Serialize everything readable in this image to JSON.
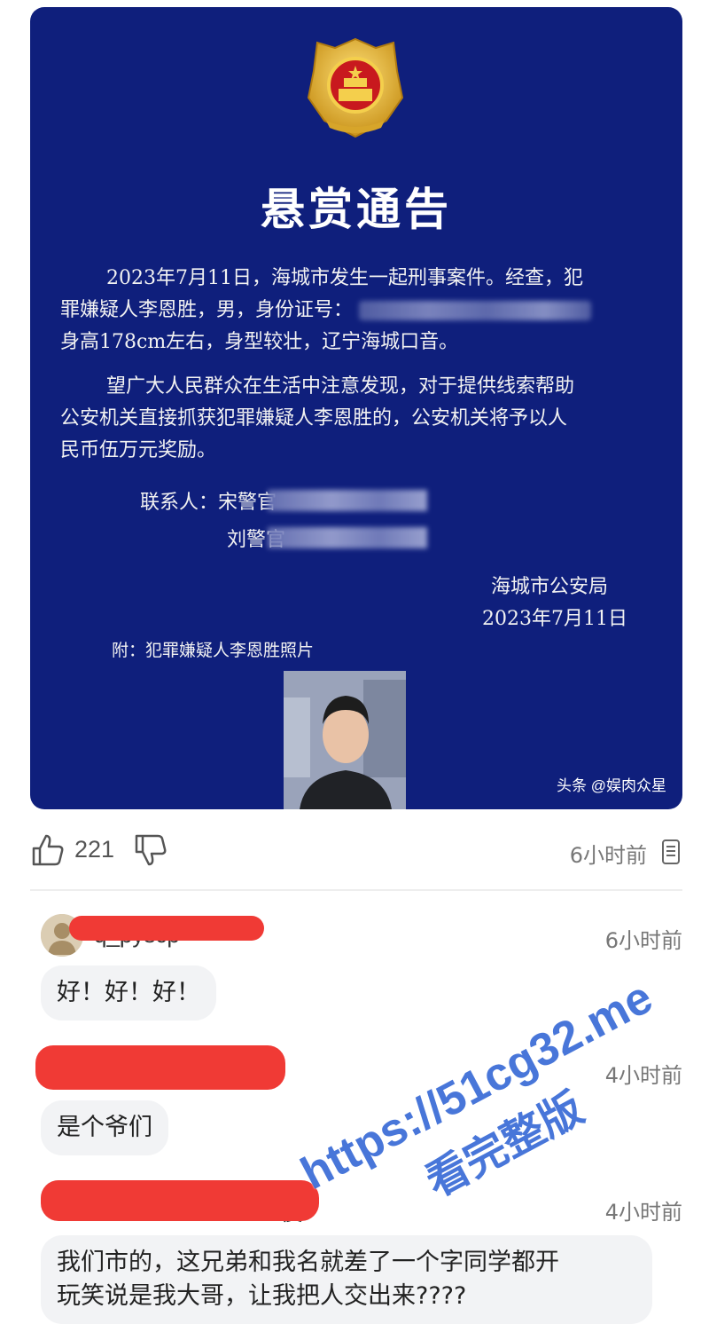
{
  "poster": {
    "title": "悬赏通告",
    "para1_line1": "2023年7月11日，海城市发生一起刑事案件。经查，犯",
    "para1_line2_prefix": "罪嫌疑人李恩胜，男，身份证号：",
    "para1_line3": "身高178cm左右，身型较壮，辽宁海城口音。",
    "para2_line1": "望广大人民群众在生活中注意发现，对于提供线索帮助",
    "para2_line2": "公安机关直接抓获犯罪嫌疑人李恩胜的，公安机关将予以人",
    "para2_line3": "民币伍万元奖励。",
    "contact_1": "联系人：宋警官",
    "contact_2": "刘警官",
    "issuer_org": "海城市公安局",
    "issuer_date": "2023年7月11日",
    "attachment": "附：犯罪嫌疑人李恩胜照片",
    "source_tag": "头条 @娱肉众星"
  },
  "actions": {
    "like_count": "221",
    "post_time": "6小时前"
  },
  "comments": [
    {
      "username": "q_pyscp",
      "time": "6小时前",
      "text": "好！好！好！"
    },
    {
      "username": "",
      "time": "4小时前",
      "text": "是个爷们"
    },
    {
      "username": "俊",
      "time": "4小时前",
      "text_line1": "我们市的，这兄弟和我名就差了一个字同学都开",
      "text_line2": "玩笑说是我大哥，让我把人交出来????"
    }
  ],
  "watermark": {
    "url": "https://51cg32.me",
    "subtitle": "看完整版"
  },
  "colors": {
    "poster_bg": "#0f1f7c",
    "redaction": "#f03a35",
    "watermark": "#3f6fd8"
  }
}
